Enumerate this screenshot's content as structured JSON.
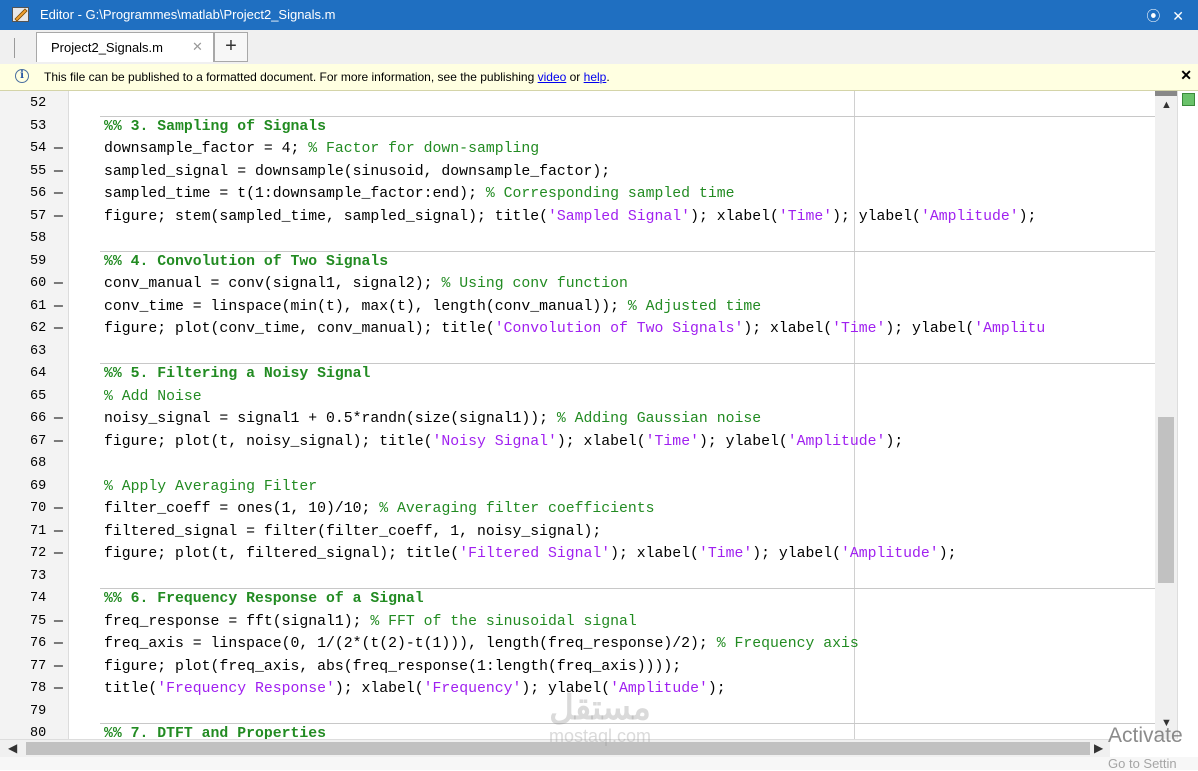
{
  "window": {
    "title": "Editor - G:\\Programmes\\matlab\\Project2_Signals.m",
    "app_icon": "matlab-editor-icon",
    "controls_icon": "options-close-icon",
    "controls_text": "⦿ ✕"
  },
  "tabs": [
    {
      "label": "Project2_Signals.m",
      "close": "✕",
      "active": true
    }
  ],
  "add_tab_label": "+",
  "infobar": {
    "icon": "info-icon",
    "icon_glyph": "i",
    "text": "This file can be published to a formatted document. For more information, see the publishing ",
    "link_video": "video",
    "mid_text": " or ",
    "link_help": "help",
    "end_text": ".",
    "close_label": "✕"
  },
  "code_lines": [
    {
      "num": "52",
      "bp": "",
      "code": "",
      "kind": "code",
      "sep": true
    },
    {
      "num": "53",
      "bp": "",
      "code": "%% 3. Sampling of Signals",
      "kind": "section"
    },
    {
      "num": "54",
      "bp": "—",
      "code": "downsample_factor = 4; % Factor for down-sampling",
      "kind": "code"
    },
    {
      "num": "55",
      "bp": "—",
      "code": "sampled_signal = downsample(sinusoid, downsample_factor);",
      "kind": "code"
    },
    {
      "num": "56",
      "bp": "—",
      "code": "sampled_time = t(1:downsample_factor:end); % Corresponding sampled time",
      "kind": "code"
    },
    {
      "num": "57",
      "bp": "—",
      "code": "figure; stem(sampled_time, sampled_signal); title('Sampled Signal'); xlabel('Time'); ylabel('Amplitude');",
      "kind": "code"
    },
    {
      "num": "58",
      "bp": "",
      "code": "",
      "kind": "code",
      "sep": true
    },
    {
      "num": "59",
      "bp": "",
      "code": "%% 4. Convolution of Two Signals",
      "kind": "section"
    },
    {
      "num": "60",
      "bp": "—",
      "code": "conv_manual = conv(signal1, signal2); % Using conv function",
      "kind": "code"
    },
    {
      "num": "61",
      "bp": "—",
      "code": "conv_time = linspace(min(t), max(t), length(conv_manual)); % Adjusted time",
      "kind": "code"
    },
    {
      "num": "62",
      "bp": "—",
      "code": "figure; plot(conv_time, conv_manual); title('Convolution of Two Signals'); xlabel('Time'); ylabel('Amplitu",
      "kind": "code"
    },
    {
      "num": "63",
      "bp": "",
      "code": "",
      "kind": "code",
      "sep": true
    },
    {
      "num": "64",
      "bp": "",
      "code": "%% 5. Filtering a Noisy Signal",
      "kind": "section"
    },
    {
      "num": "65",
      "bp": "",
      "code": "% Add Noise",
      "kind": "comment"
    },
    {
      "num": "66",
      "bp": "—",
      "code": "noisy_signal = signal1 + 0.5*randn(size(signal1)); % Adding Gaussian noise",
      "kind": "code"
    },
    {
      "num": "67",
      "bp": "—",
      "code": "figure; plot(t, noisy_signal); title('Noisy Signal'); xlabel('Time'); ylabel('Amplitude');",
      "kind": "code"
    },
    {
      "num": "68",
      "bp": "",
      "code": "",
      "kind": "code"
    },
    {
      "num": "69",
      "bp": "",
      "code": "% Apply Averaging Filter",
      "kind": "comment"
    },
    {
      "num": "70",
      "bp": "—",
      "code": "filter_coeff = ones(1, 10)/10; % Averaging filter coefficients",
      "kind": "code"
    },
    {
      "num": "71",
      "bp": "—",
      "code": "filtered_signal = filter(filter_coeff, 1, noisy_signal);",
      "kind": "code"
    },
    {
      "num": "72",
      "bp": "—",
      "code": "figure; plot(t, filtered_signal); title('Filtered Signal'); xlabel('Time'); ylabel('Amplitude');",
      "kind": "code"
    },
    {
      "num": "73",
      "bp": "",
      "code": "",
      "kind": "code",
      "sep": true
    },
    {
      "num": "74",
      "bp": "",
      "code": "%% 6. Frequency Response of a Signal",
      "kind": "section"
    },
    {
      "num": "75",
      "bp": "—",
      "code": "freq_response = fft(signal1); % FFT of the sinusoidal signal",
      "kind": "code"
    },
    {
      "num": "76",
      "bp": "—",
      "code": "freq_axis = linspace(0, 1/(2*(t(2)-t(1))), length(freq_response)/2); % Frequency axis",
      "kind": "code"
    },
    {
      "num": "77",
      "bp": "—",
      "code": "figure; plot(freq_axis, abs(freq_response(1:length(freq_axis))));",
      "kind": "code"
    },
    {
      "num": "78",
      "bp": "—",
      "code": "title('Frequency Response'); xlabel('Frequency'); ylabel('Amplitude');",
      "kind": "code"
    },
    {
      "num": "79",
      "bp": "",
      "code": "",
      "kind": "code",
      "sep": true
    },
    {
      "num": "80",
      "bp": "",
      "code": "%% 7. DTFT and Properties",
      "kind": "section"
    }
  ],
  "scrollbars": {
    "up": "▲",
    "down": "▼",
    "left": "◀",
    "right": "▶"
  },
  "watermark": {
    "arabic": "مستقل",
    "latin": "mostaql.com"
  },
  "os_overlay": {
    "activate": "Activate",
    "goto": "Go to Settin"
  },
  "colors": {
    "titlebar": "#1f6fc1",
    "comment": "#228b22",
    "string": "#a020f0",
    "infobar": "#ffffe1"
  }
}
